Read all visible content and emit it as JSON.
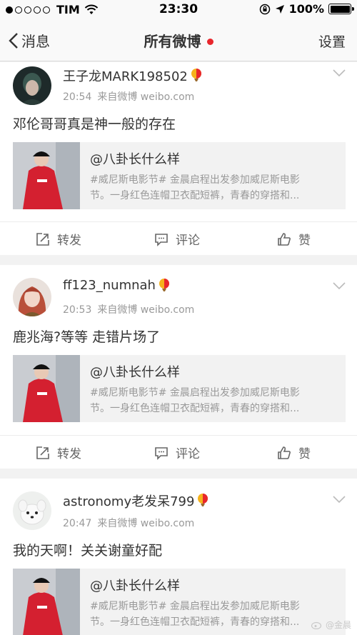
{
  "status_bar": {
    "carrier": "TIM",
    "time": "23:30",
    "battery": "100%"
  },
  "nav": {
    "back_label": "消息",
    "title": "所有微博",
    "settings_label": "设置"
  },
  "quote": {
    "user": "@八卦长什么样",
    "line1": "#威尼斯电影节# 金晨启程出发参加威尼斯电影",
    "line2": "节。一身红色连帽卫衣配短裤，青春的穿搭和..."
  },
  "actions": {
    "repost": "转发",
    "comment": "评论",
    "like": "赞"
  },
  "posts": [
    {
      "username": "王子龙MARK198502",
      "time": "20:54",
      "source": "来自微博 weibo.com",
      "text": "邓伦哥哥真是神一般的存在"
    },
    {
      "username": "ff123_numnah",
      "time": "20:53",
      "source": "来自微博 weibo.com",
      "text": "鹿兆海?等等 走错片场了"
    },
    {
      "username": "astronomy老发呆799",
      "time": "20:47",
      "source": "来自微博 weibo.com",
      "text": "我的天啊！关关谢童好配"
    }
  ],
  "watermark": "@金晨",
  "colors": {
    "accent_red": "#e8262c",
    "text": "#333333",
    "meta": "#999999",
    "background": "#f2f2f2"
  },
  "icons": [
    "wifi-icon",
    "lock-rotation-icon",
    "location-arrow-icon",
    "battery-icon",
    "back-chevron-icon",
    "vip-balloon-icon",
    "dropdown-chevron-icon",
    "repost-icon",
    "comment-icon",
    "like-icon"
  ]
}
